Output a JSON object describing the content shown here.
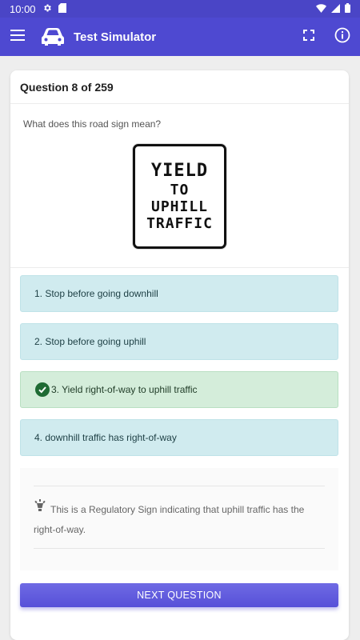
{
  "status_bar": {
    "time": "10:00",
    "icons": [
      "gear-icon",
      "sim-card-icon",
      "wifi-icon",
      "signal-icon",
      "battery-icon"
    ]
  },
  "app_bar": {
    "title": "Test Simulator",
    "icons": [
      "menu-icon",
      "car-icon",
      "fullscreen-icon",
      "info-icon"
    ],
    "background": "#4e49d1"
  },
  "question": {
    "header": "Question 8 of 259",
    "prompt": "What does this road sign mean?",
    "sign_lines": [
      "YIELD",
      "TO",
      "UPHILL",
      "TRAFFIC"
    ]
  },
  "options": [
    {
      "label": "1. Stop before going downhill",
      "correct": false
    },
    {
      "label": "2. Stop before going uphill",
      "correct": false
    },
    {
      "label": "3. Yield right-of-way to uphill traffic",
      "correct": true
    },
    {
      "label": "4. downhill traffic has right-of-way",
      "correct": false
    }
  ],
  "explanation": {
    "icon": "lightbulb-icon",
    "text": "This is a Regulatory Sign indicating that uphill traffic has the right-of-way."
  },
  "next_button": {
    "label": "NEXT QUESTION",
    "color": "#5a55da"
  },
  "colors": {
    "option_bg": "#d0ebef",
    "correct_bg": "#d4edda",
    "correct_check": "#1f6b34"
  }
}
